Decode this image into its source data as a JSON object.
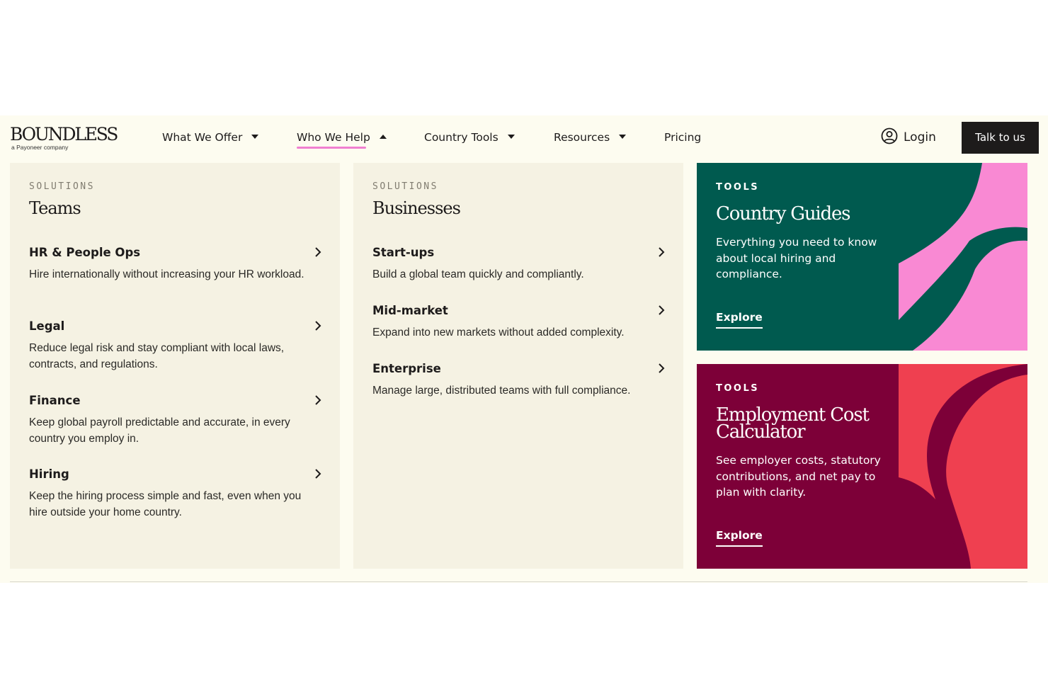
{
  "logo": {
    "name": "BOUNDLESS",
    "tagline": "a Payoneer company"
  },
  "nav": {
    "items": [
      {
        "label": "What We Offer",
        "caret": "down"
      },
      {
        "label": "Who We Help",
        "caret": "up",
        "active": true
      },
      {
        "label": "Country Tools",
        "caret": "down"
      },
      {
        "label": "Resources",
        "caret": "down"
      },
      {
        "label": "Pricing"
      }
    ],
    "active_underline_color": "#f07fd0",
    "login_label": "Login",
    "cta_label": "Talk to us"
  },
  "menu": {
    "teams": {
      "eyebrow": "SOLUTIONS",
      "title": "Teams",
      "items": [
        {
          "title": "HR & People Ops",
          "desc": "Hire internationally without increasing your HR workload."
        },
        {
          "title": "Legal",
          "desc": "Reduce legal risk and stay compliant with local laws, contracts, and regulations."
        },
        {
          "title": "Finance",
          "desc": "Keep global payroll predictable and accurate, in every country you employ in."
        },
        {
          "title": "Hiring",
          "desc": "Keep the hiring process simple and fast, even when you hire outside your home country."
        }
      ]
    },
    "businesses": {
      "eyebrow": "SOLUTIONS",
      "title": "Businesses",
      "items": [
        {
          "title": "Start-ups",
          "desc": "Build a global team quickly and compliantly."
        },
        {
          "title": "Mid-market",
          "desc": "Expand into new markets without added complexity."
        },
        {
          "title": "Enterprise",
          "desc": "Manage large, distributed teams with full compliance."
        }
      ]
    },
    "tools": [
      {
        "eyebrow": "TOOLS",
        "title": "Country Guides",
        "desc": "Everything you need to know about local hiring and compliance.",
        "link": "Explore",
        "bg_color": "#005a4f",
        "art_color": "#f989d3"
      },
      {
        "eyebrow": "TOOLS",
        "title": "Employment Cost Calculator",
        "desc": "See employer costs, statutory contributions, and net pay to plan with clarity.",
        "link": "Explore",
        "bg_color": "#7d0038",
        "art_color": "#ef4050"
      }
    ]
  }
}
